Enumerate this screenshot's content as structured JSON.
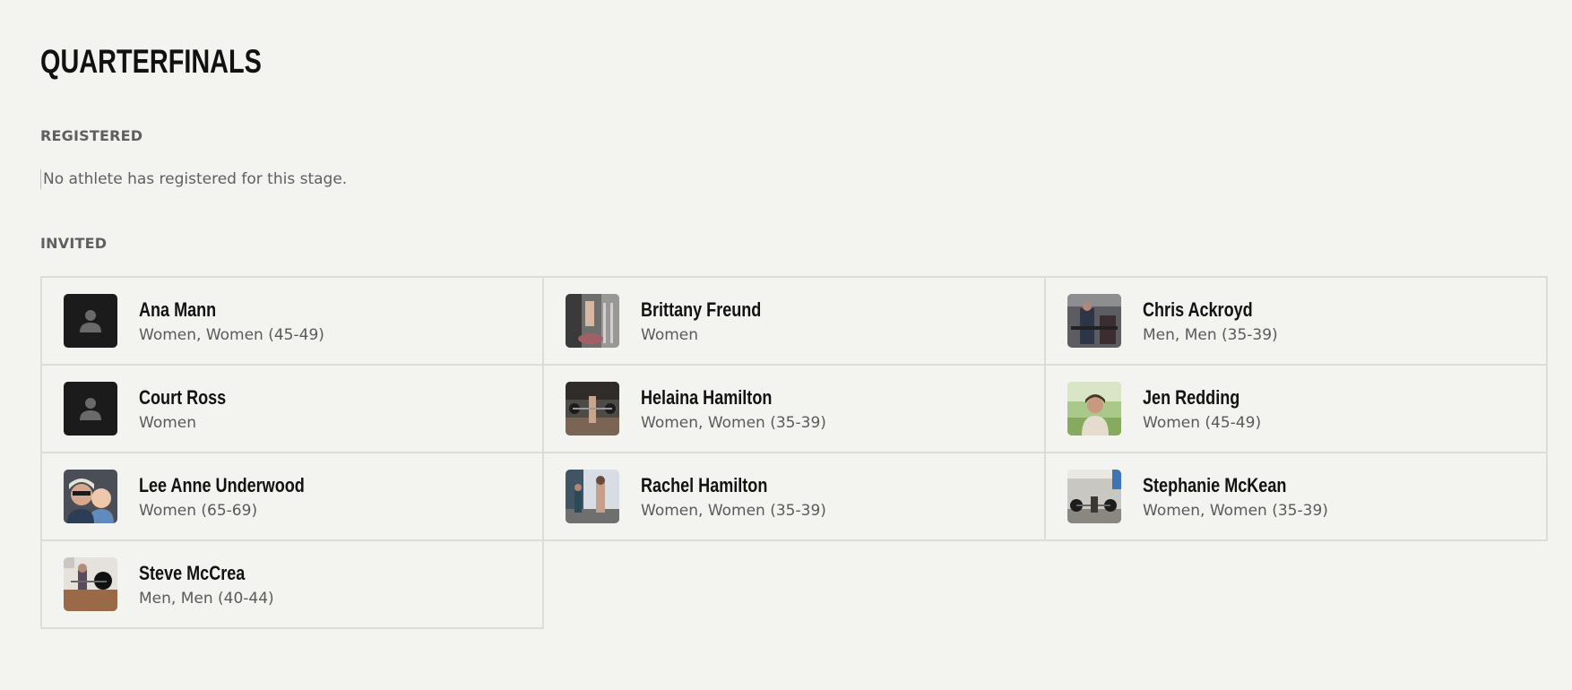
{
  "stage": {
    "title": "QUARTERFINALS"
  },
  "registered": {
    "label": "REGISTERED",
    "empty_message": "No athlete has registered for this stage."
  },
  "invited": {
    "label": "INVITED",
    "athletes": [
      {
        "name": "Ana Mann",
        "division": "Women, Women (45-49)",
        "photo": "placeholder"
      },
      {
        "name": "Brittany Freund",
        "division": "Women",
        "photo": "photo"
      },
      {
        "name": "Chris Ackroyd",
        "division": "Men, Men (35-39)",
        "photo": "photo"
      },
      {
        "name": "Court Ross",
        "division": "Women",
        "photo": "placeholder"
      },
      {
        "name": "Helaina Hamilton",
        "division": "Women, Women (35-39)",
        "photo": "photo"
      },
      {
        "name": "Jen Redding",
        "division": "Women (45-49)",
        "photo": "photo"
      },
      {
        "name": "Lee Anne Underwood",
        "division": "Women (65-69)",
        "photo": "photo"
      },
      {
        "name": "Rachel Hamilton",
        "division": "Women, Women (35-39)",
        "photo": "photo"
      },
      {
        "name": "Stephanie McKean",
        "division": "Women, Women (35-39)",
        "photo": "photo"
      },
      {
        "name": "Steve McCrea",
        "division": "Men, Men (40-44)",
        "photo": "photo"
      }
    ]
  }
}
